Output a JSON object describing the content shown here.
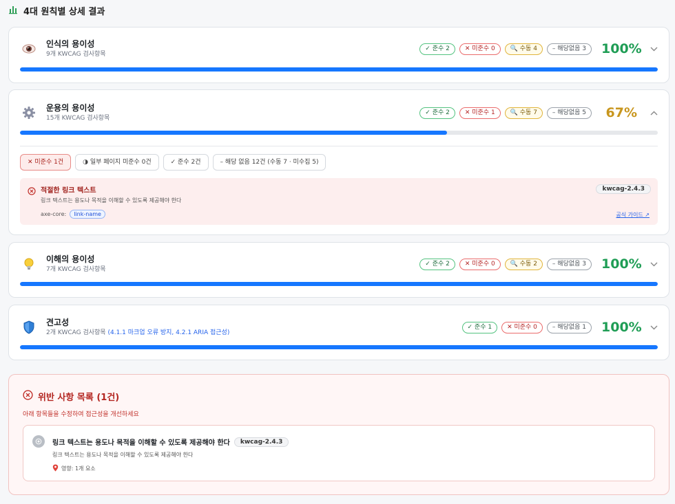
{
  "header": {
    "title": "4대 원칙별 상세 결과",
    "icon": "bar-chart-icon"
  },
  "principles": [
    {
      "name": "인식의 용이성",
      "sub": "9개 KWCAG 검사항목",
      "sub_detail": "",
      "icon": "eye-icon",
      "badges": {
        "pass": "✓ 준수 2",
        "fail": "✕ 미준수 0",
        "manual": "🔍 수동 4",
        "na": "– 해당없음 3"
      },
      "score": "100%",
      "progress": 1.0,
      "expanded": false
    },
    {
      "name": "운용의 용이성",
      "sub": "15개 KWCAG 검사항목",
      "sub_detail": "",
      "icon": "gear-icon",
      "badges": {
        "pass": "✓ 준수 2",
        "fail": "✕ 미준수 1",
        "manual": "🔍 수동 7",
        "na": "– 해당없음 5"
      },
      "score": "67%",
      "progress": 0.67,
      "expanded": true
    },
    {
      "name": "이해의 용이성",
      "sub": "7개 KWCAG 검사항목",
      "sub_detail": "",
      "icon": "lightbulb-icon",
      "badges": {
        "pass": "✓ 준수 2",
        "fail": "✕ 미준수 0",
        "manual": "🔍 수동 2",
        "na": "– 해당없음 3"
      },
      "score": "100%",
      "progress": 1.0,
      "expanded": false
    },
    {
      "name": "견고성",
      "sub": "2개 KWCAG 검사항목",
      "sub_detail": "(4.1.1 마크업 오류 방지, 4.2.1 ARIA 접근성)",
      "icon": "shield-icon",
      "badges": {
        "pass": "✓ 준수 1",
        "fail": "✕ 미준수 0",
        "na": "– 해당없음 1"
      },
      "score": "100%",
      "progress": 1.0,
      "expanded": false
    }
  ],
  "filters": [
    "✕ 미준수 1건",
    "◑ 일부 페이지 미준수 0건",
    "✓ 준수 2건",
    "– 해당 없음 12건 (수동 7 · 미수집 5)"
  ],
  "violation_detail": {
    "title": "적절한 링크 텍스트",
    "description": "링크 텍스트는 용도나 목적을 이해할 수 있도록 제공해야 한다",
    "axe_label": "axe-core:",
    "axe_rule": "link-name",
    "kwcag": "kwcag-2.4.3",
    "guide_link": "공식 가이드 ↗"
  },
  "summary": {
    "title": "위반 사항 목록 (1건)",
    "subtitle": "아래 항목들을 수정하여 접근성을 개선하세요",
    "item": {
      "title": "링크 텍스트는 용도나 목적을 이해할 수 있도록 제공해야 한다",
      "kwcag": "kwcag-2.4.3",
      "description": "링크 텍스트는 용도나 목적을 이해할 수 있도록 제공해야 한다",
      "impact": "영향: 1개 요소"
    }
  },
  "colors": {
    "accent": "#1677ff",
    "pass": "#1f9d55",
    "warn": "#c8961e",
    "fail": "#b32520"
  }
}
